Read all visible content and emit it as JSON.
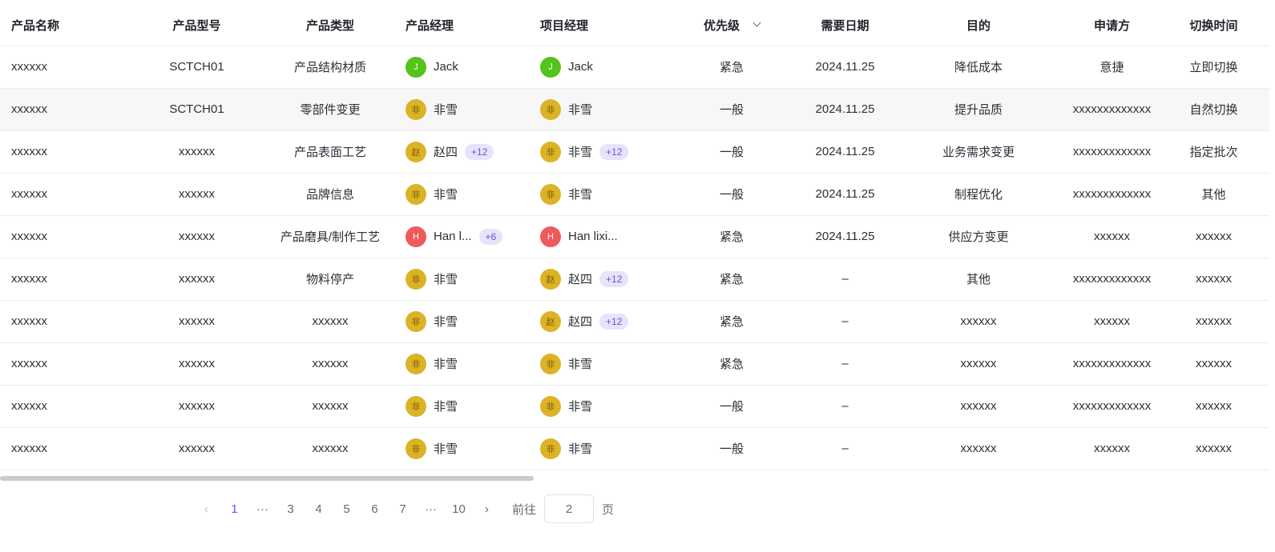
{
  "headers": [
    "产品名称",
    "产品型号",
    "产品类型",
    "产品经理",
    "项目经理",
    "优先级",
    "需要日期",
    "目的",
    "申请方",
    "切换时间"
  ],
  "rows": [
    {
      "name": "xxxxxx",
      "model": "SCTCH01",
      "type": "产品结构材质",
      "pm": {
        "avatar": "J",
        "color": "green",
        "name": "Jack",
        "more": ""
      },
      "proj": {
        "avatar": "J",
        "color": "green",
        "name": "Jack",
        "more": ""
      },
      "priority": "紧急",
      "date": "2024.11.25",
      "purpose": "降低成本",
      "applicant": "意捷",
      "switch": "立即切换"
    },
    {
      "name": "xxxxxx",
      "model": "SCTCH01",
      "type": "零部件变更",
      "pm": {
        "avatar": "非",
        "color": "yellow",
        "name": "非雪",
        "more": ""
      },
      "proj": {
        "avatar": "非",
        "color": "yellow",
        "name": "非雪",
        "more": ""
      },
      "priority": "一般",
      "date": "2024.11.25",
      "purpose": "提升品质",
      "applicant": "xxxxxxxxxxxxx",
      "switch": "自然切换"
    },
    {
      "name": "xxxxxx",
      "model": "xxxxxx",
      "type": "产品表面工艺",
      "pm": {
        "avatar": "赵",
        "color": "yellow",
        "name": "赵四",
        "more": "+12"
      },
      "proj": {
        "avatar": "非",
        "color": "yellow",
        "name": "非雪",
        "more": "+12"
      },
      "priority": "一般",
      "date": "2024.11.25",
      "purpose": "业务需求变更",
      "applicant": "xxxxxxxxxxxxx",
      "switch": "指定批次"
    },
    {
      "name": "xxxxxx",
      "model": "xxxxxx",
      "type": "品牌信息",
      "pm": {
        "avatar": "非",
        "color": "yellow",
        "name": "非雪",
        "more": ""
      },
      "proj": {
        "avatar": "非",
        "color": "yellow",
        "name": "非雪",
        "more": ""
      },
      "priority": "一般",
      "date": "2024.11.25",
      "purpose": "制程优化",
      "applicant": "xxxxxxxxxxxxx",
      "switch": "其他"
    },
    {
      "name": "xxxxxx",
      "model": "xxxxxx",
      "type": "产品磨具/制作工艺",
      "pm": {
        "avatar": "H",
        "color": "red",
        "name": "Han l...",
        "more": "+6"
      },
      "proj": {
        "avatar": "H",
        "color": "red",
        "name": "Han lixi...",
        "more": ""
      },
      "priority": "紧急",
      "date": "2024.11.25",
      "purpose": "供应方变更",
      "applicant": "xxxxxx",
      "switch": "xxxxxx"
    },
    {
      "name": "xxxxxx",
      "model": "xxxxxx",
      "type": "物料停产",
      "pm": {
        "avatar": "非",
        "color": "yellow",
        "name": "非雪",
        "more": ""
      },
      "proj": {
        "avatar": "赵",
        "color": "yellow",
        "name": "赵四",
        "more": "+12"
      },
      "priority": "紧急",
      "date": "–",
      "purpose": "其他",
      "applicant": "xxxxxxxxxxxxx",
      "switch": "xxxxxx"
    },
    {
      "name": "xxxxxx",
      "model": "xxxxxx",
      "type": "xxxxxx",
      "pm": {
        "avatar": "非",
        "color": "yellow",
        "name": "非雪",
        "more": ""
      },
      "proj": {
        "avatar": "赵",
        "color": "yellow",
        "name": "赵四",
        "more": "+12"
      },
      "priority": "紧急",
      "date": "–",
      "purpose": "xxxxxx",
      "applicant": "xxxxxx",
      "switch": "xxxxxx"
    },
    {
      "name": "xxxxxx",
      "model": "xxxxxx",
      "type": "xxxxxx",
      "pm": {
        "avatar": "非",
        "color": "yellow",
        "name": "非雪",
        "more": ""
      },
      "proj": {
        "avatar": "非",
        "color": "yellow",
        "name": "非雪",
        "more": ""
      },
      "priority": "紧急",
      "date": "–",
      "purpose": "xxxxxx",
      "applicant": "xxxxxxxxxxxxx",
      "switch": "xxxxxx"
    },
    {
      "name": "xxxxxx",
      "model": "xxxxxx",
      "type": "xxxxxx",
      "pm": {
        "avatar": "非",
        "color": "yellow",
        "name": "非雪",
        "more": ""
      },
      "proj": {
        "avatar": "非",
        "color": "yellow",
        "name": "非雪",
        "more": ""
      },
      "priority": "一般",
      "date": "–",
      "purpose": "xxxxxx",
      "applicant": "xxxxxxxxxxxxx",
      "switch": "xxxxxx"
    },
    {
      "name": "xxxxxx",
      "model": "xxxxxx",
      "type": "xxxxxx",
      "pm": {
        "avatar": "非",
        "color": "yellow",
        "name": "非雪",
        "more": ""
      },
      "proj": {
        "avatar": "非",
        "color": "yellow",
        "name": "非雪",
        "more": ""
      },
      "priority": "一般",
      "date": "–",
      "purpose": "xxxxxx",
      "applicant": "xxxxxx",
      "switch": "xxxxxx"
    }
  ],
  "pagination": {
    "prev_icon": "chevron-left-icon",
    "next_icon": "chevron-right-icon",
    "items": [
      "1",
      "···",
      "3",
      "4",
      "5",
      "6",
      "7",
      "···",
      "10"
    ],
    "current": "1",
    "goto_label": "前往",
    "goto_value": "2",
    "page_suffix": "页"
  },
  "colors": {
    "accent": "#4e5bff",
    "avatar_green": "#52c41a",
    "avatar_yellow": "#dcb327",
    "avatar_red": "#f05a5a",
    "tag_bg": "#e8e3fb",
    "tag_text": "#6b51d6"
  }
}
